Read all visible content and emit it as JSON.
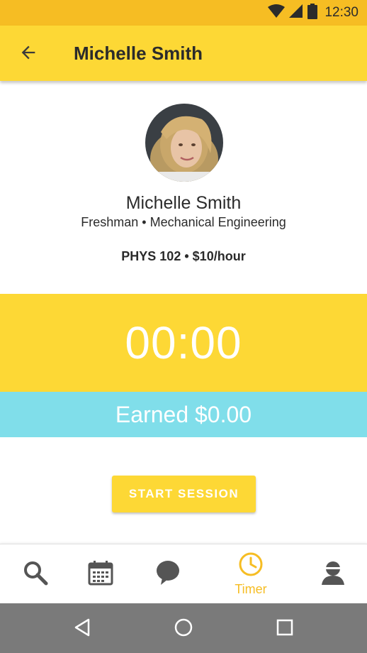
{
  "status_bar": {
    "time": "12:30"
  },
  "header": {
    "title": "Michelle Smith"
  },
  "profile": {
    "name": "Michelle Smith",
    "year": "Freshman",
    "major": "Mechanical Engineering",
    "course": "PHYS 102",
    "rate": "$10/hour"
  },
  "timer": {
    "value": "00:00",
    "earned": "Earned $0.00"
  },
  "actions": {
    "start_label": "START SESSION"
  },
  "bottom_nav": [
    {
      "icon": "search-icon",
      "label": "",
      "active": false
    },
    {
      "icon": "calendar-icon",
      "label": "",
      "active": false
    },
    {
      "icon": "chat-bubble-icon",
      "label": "",
      "active": false
    },
    {
      "icon": "clock-icon",
      "label": "Timer",
      "active": true
    },
    {
      "icon": "person-icon",
      "label": "",
      "active": false
    }
  ],
  "colors": {
    "primary": "#FDD835",
    "status_bar": "#F6BD23",
    "accent_cyan": "#80DEEA",
    "active_nav": "#F6BD23",
    "icon_gray": "#555555",
    "system_nav": "#7a7a7a"
  }
}
